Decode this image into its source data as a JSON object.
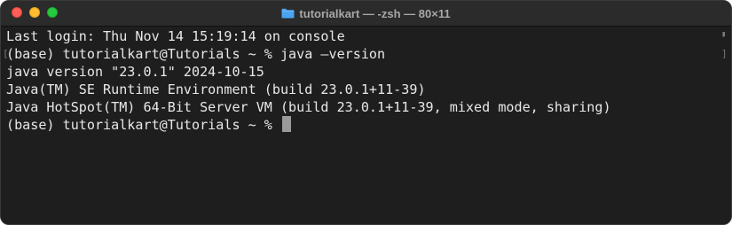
{
  "window": {
    "title": "tutorialkart — -zsh — 80×11",
    "title_icon": "folder-icon",
    "accent_folder_color": "#4aa3f0"
  },
  "traffic_lights": {
    "close_color": "#ff5f57",
    "minimize_color": "#febc2e",
    "maximize_color": "#28c840"
  },
  "terminal": {
    "lines": [
      "Last login: Thu Nov 14 15:19:14 on console",
      "(base) tutorialkart@Tutorials ~ % java —version",
      "java version \"23.0.1\" 2024-10-15",
      "Java(TM) SE Runtime Environment (build 23.0.1+11-39)",
      "Java HotSpot(TM) 64-Bit Server VM (build 23.0.1+11-39, mixed mode, sharing)",
      "(base) tutorialkart@Tutorials ~ % "
    ],
    "background": "#1e1e1e",
    "foreground": "#e8e8e8"
  }
}
